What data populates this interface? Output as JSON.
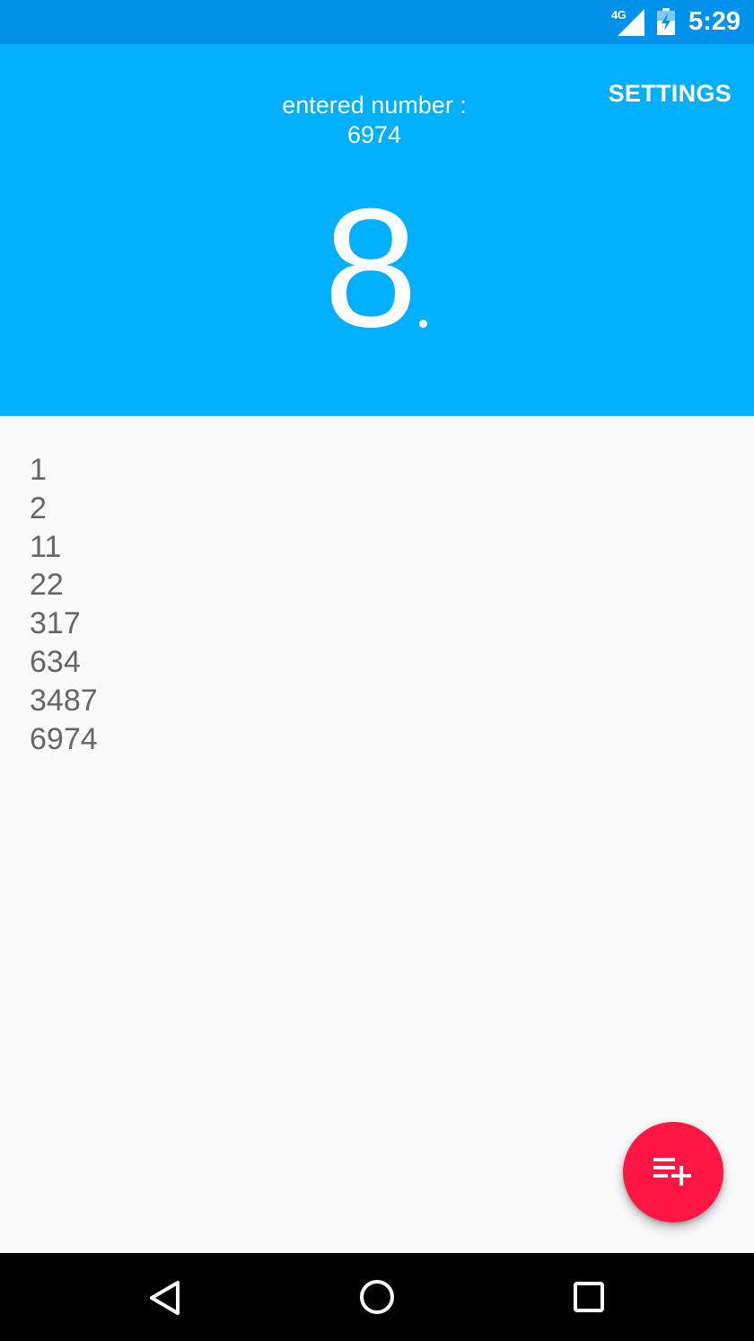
{
  "status_bar": {
    "network_type": "4G",
    "time": "5:29",
    "icons": [
      "signal-icon",
      "battery-icon"
    ]
  },
  "header": {
    "settings_label": "SETTINGS",
    "entered_label": "entered number :",
    "entered_value": "6974",
    "result_value": "8"
  },
  "divisors": {
    "items": [
      "1",
      "2",
      "11",
      "22",
      "317",
      "634",
      "3487",
      "6974"
    ]
  },
  "fab": {
    "icon": "playlist-add-icon",
    "color": "#ff1744"
  },
  "nav_bar": {
    "icons": [
      "back-icon",
      "home-icon",
      "recent-apps-icon"
    ]
  },
  "colors": {
    "status_bar": "#0091ea",
    "header": "#00b0ff",
    "background": "#fafafa",
    "list_text": "#666666"
  }
}
